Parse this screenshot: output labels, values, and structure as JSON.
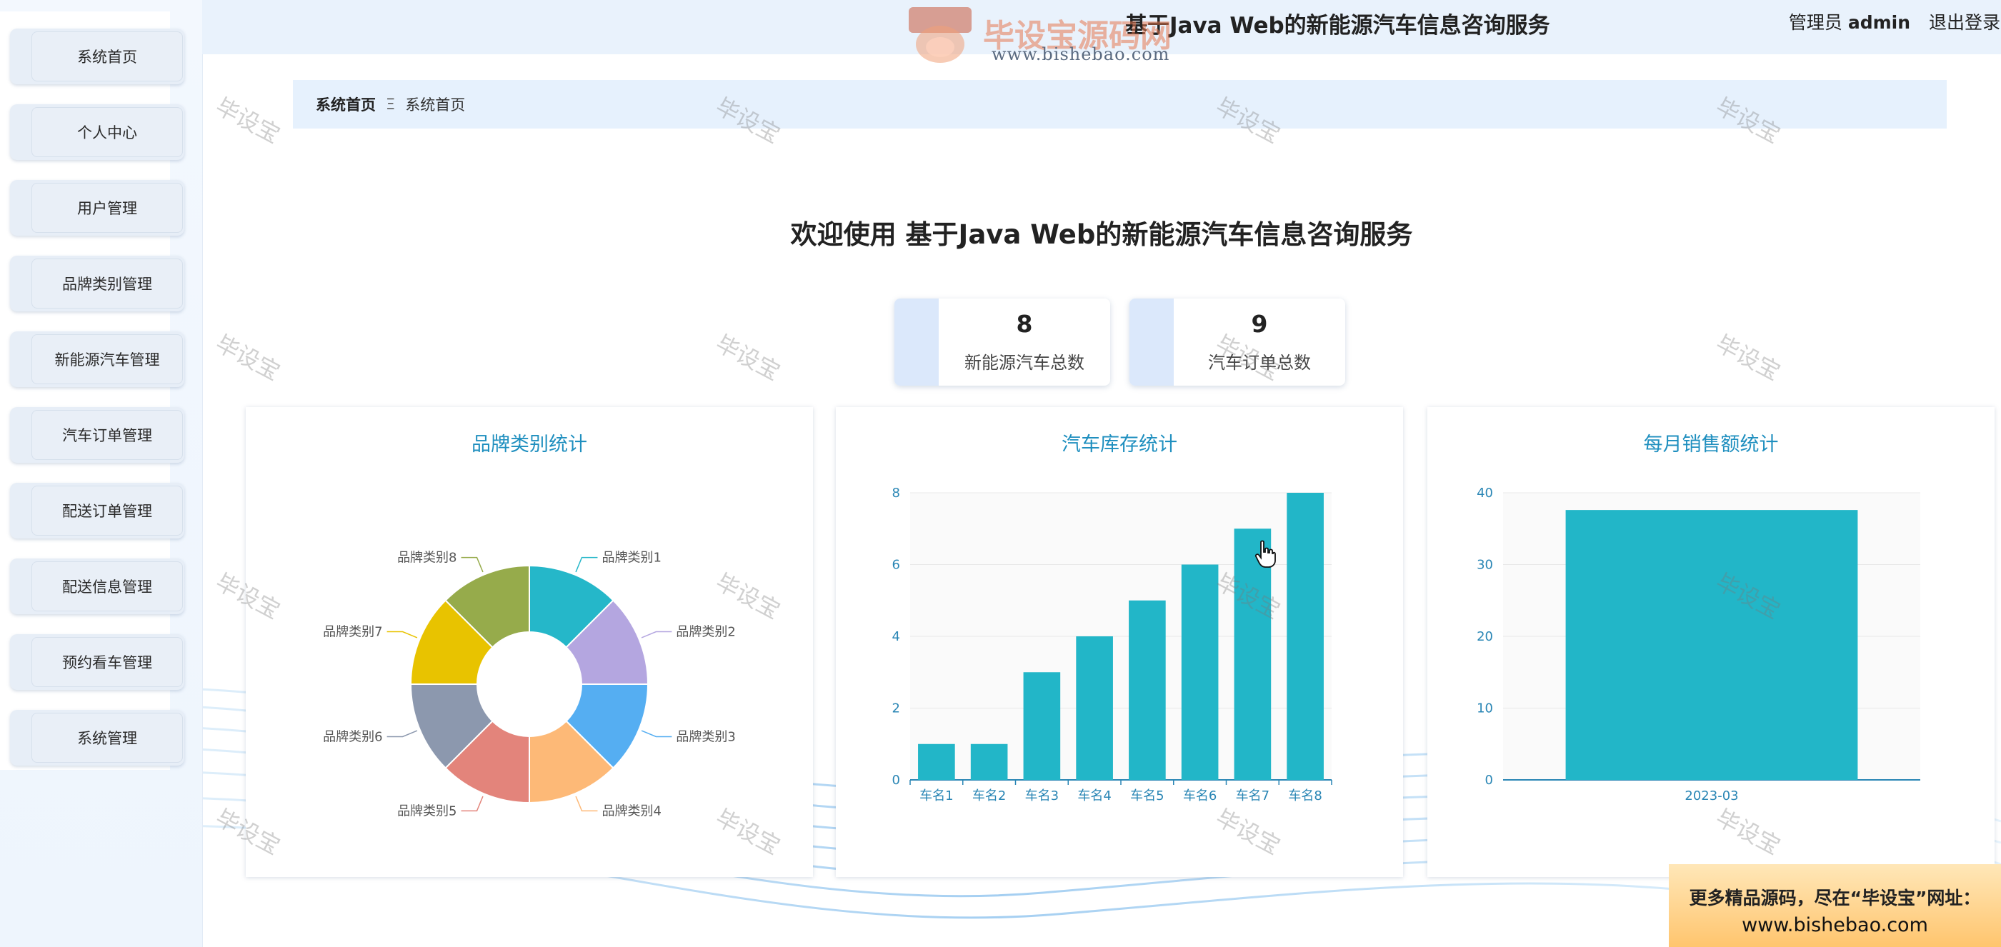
{
  "header": {
    "title": "基于Java Web的新能源汽车信息咨询服务",
    "user_prefix": "管理员",
    "user_name": "admin",
    "logout_label": "退出登录"
  },
  "watermark": {
    "logo_text": "毕设宝源码网",
    "url": "www.bishebao.com",
    "stamp": "毕设宝"
  },
  "sidebar": {
    "items": [
      {
        "label": "系统首页"
      },
      {
        "label": "个人中心"
      },
      {
        "label": "用户管理"
      },
      {
        "label": "品牌类别管理"
      },
      {
        "label": "新能源汽车管理"
      },
      {
        "label": "汽车订单管理"
      },
      {
        "label": "配送订单管理"
      },
      {
        "label": "配送信息管理"
      },
      {
        "label": "预约看车管理"
      },
      {
        "label": "系统管理"
      }
    ]
  },
  "breadcrumb": {
    "home": "系统首页",
    "separator": "Ξ",
    "current": "系统首页"
  },
  "welcome": "欢迎使用 基于Java Web的新能源汽车信息咨询服务",
  "stats": [
    {
      "value": "8",
      "label": "新能源汽车总数"
    },
    {
      "value": "9",
      "label": "汽车订单总数"
    }
  ],
  "ad": {
    "line1": "更多精品源码，尽在“毕设宝”网址：",
    "line2": "www.bishebao.com"
  },
  "colors": {
    "accent": "#1f8fbf",
    "bar": "#22b6c8",
    "header_bg": "#e9f2fc"
  },
  "chart_data": [
    {
      "type": "pie",
      "title": "品牌类别统计",
      "categories": [
        "品牌类别1",
        "品牌类别2",
        "品牌类别3",
        "品牌类别4",
        "品牌类别5",
        "品牌类别6",
        "品牌类别7",
        "品牌类别8"
      ],
      "values": [
        1,
        1,
        1,
        1,
        1,
        1,
        1,
        1
      ],
      "colors": [
        "#25b7c9",
        "#b4a6e0",
        "#55aef2",
        "#fdb977",
        "#e3847b",
        "#8c98ae",
        "#e8c300",
        "#96ab4b"
      ],
      "donut": true,
      "legend": "none"
    },
    {
      "type": "bar",
      "title": "汽车库存统计",
      "categories": [
        "车名1",
        "车名2",
        "车名3",
        "车名4",
        "车名5",
        "车名6",
        "车名7",
        "车名8"
      ],
      "values": [
        1,
        1,
        3,
        4,
        5,
        6,
        7,
        8
      ],
      "ylim": [
        0,
        8
      ],
      "yticks": [
        0,
        2,
        4,
        6,
        8
      ],
      "grid": true
    },
    {
      "type": "bar",
      "title": "每月销售额统计",
      "categories": [
        "2023-03"
      ],
      "values": [
        37.6
      ],
      "ylim": [
        0,
        40
      ],
      "yticks": [
        0,
        10,
        20,
        30,
        40
      ],
      "grid": true
    }
  ]
}
